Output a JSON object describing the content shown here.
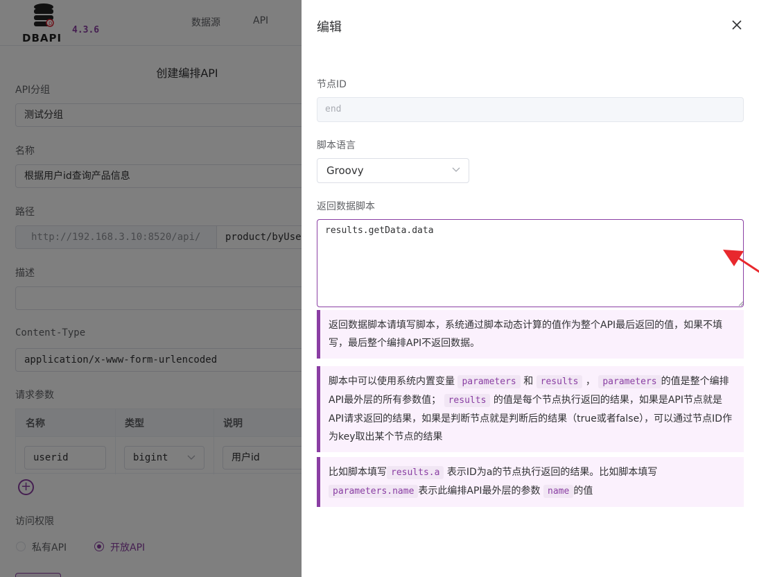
{
  "app": {
    "logo_text": "DBAPI",
    "version": "4.3.6"
  },
  "nav": {
    "items": [
      "数据源",
      "API"
    ]
  },
  "form": {
    "heading": "创建编排API",
    "group": {
      "label": "API分组",
      "value": "测试分组"
    },
    "name": {
      "label": "名称",
      "value": "根据用户id查询产品信息"
    },
    "path": {
      "label": "路径",
      "prefix": "http://192.168.3.10:8520/api/",
      "value": "product/byUse"
    },
    "desc": {
      "label": "描述",
      "value": ""
    },
    "content_type": {
      "label": "Content-Type",
      "value": "application/x-www-form-urlencoded"
    },
    "params": {
      "label": "请求参数",
      "headers": [
        "名称",
        "类型",
        "说明"
      ],
      "row": {
        "name": "userid",
        "type": "bigint",
        "desc": "用户id"
      }
    },
    "access": {
      "label": "访问权限",
      "private_label": "私有API",
      "public_label": "开放API",
      "selected": "public"
    }
  },
  "drawer": {
    "title": "编辑",
    "node_id": {
      "label": "节点ID",
      "value": "end"
    },
    "lang": {
      "label": "脚本语言",
      "value": "Groovy"
    },
    "script": {
      "label": "返回数据脚本",
      "value": "results.getData.data"
    },
    "tip1": {
      "text": "返回数据脚本请填写脚本，系统通过脚本动态计算的值作为整个API最后返回的值，如果不填写，最后整个编排API不返回数据。"
    },
    "tip2": {
      "t1": "脚本中可以使用系统内置变量",
      "c1": "parameters",
      "t2": "和",
      "c2": "results",
      "t3": "，",
      "c3": "parameters",
      "t4": "的值是整个编排API最外层的所有参数值；",
      "c4": "results",
      "t5": "的值是每个节点执行返回的结果，如果是API节点就是API请求返回的结果，如果是判断节点就是判断后的结果（true或者false），可以通过节点ID作为key取出某个节点的结果"
    },
    "tip3": {
      "t1": "比如脚本填写",
      "c1": "results.a",
      "t2": "表示ID为a的节点执行返回的结果。比如脚本填写",
      "c2": "parameters.name",
      "t3": "表示此编排API最外层的参数",
      "c3": "name",
      "t4": "的值"
    }
  },
  "colors": {
    "accent": "#8a3ea3",
    "tip_bg": "#fbf1fd",
    "arrow": "#e8282d"
  },
  "icons": [
    "database-logo-icon",
    "close-icon",
    "chevron-down-icon",
    "plus-circle-icon",
    "annotation-arrow-icon"
  ]
}
